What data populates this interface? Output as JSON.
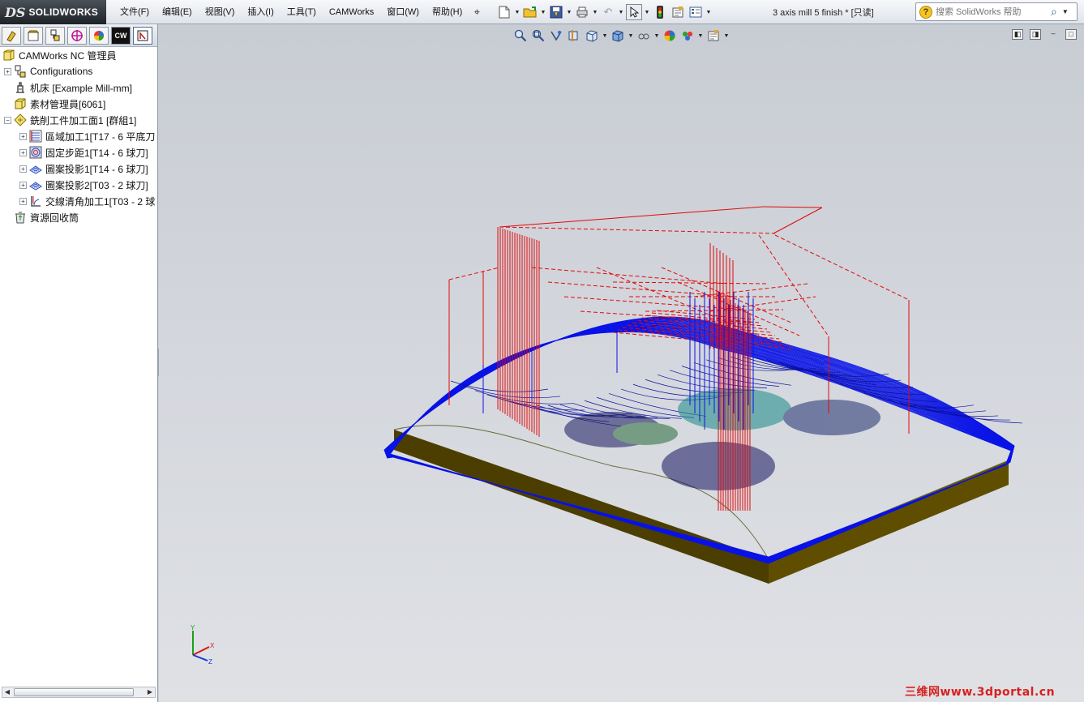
{
  "app": {
    "logo_mark": "DS",
    "logo_text": "SOLIDWORKS",
    "document_title": "3 axis mill 5 finish * [只读]"
  },
  "menu": [
    {
      "key": "file",
      "label": "文件(F)"
    },
    {
      "key": "edit",
      "label": "编辑(E)"
    },
    {
      "key": "view",
      "label": "视图(V)"
    },
    {
      "key": "insert",
      "label": "插入(I)"
    },
    {
      "key": "tools",
      "label": "工具(T)"
    },
    {
      "key": "camworks",
      "label": "CAMWorks"
    },
    {
      "key": "window",
      "label": "窗口(W)"
    },
    {
      "key": "help",
      "label": "帮助(H)"
    }
  ],
  "search": {
    "placeholder": "搜索 SolidWorks 帮助",
    "icon": "magnifier-icon"
  },
  "panel_tabs": [
    "feature-manager-icon",
    "property-manager-icon",
    "configuration-manager-icon",
    "dimxpert-icon",
    "display-manager-icon",
    "camworks-feature-tree-icon",
    "camworks-operation-tree-icon"
  ],
  "tree": {
    "root": "CAMWorks NC 管理員",
    "items": [
      {
        "label": "Configurations",
        "icon": "configurations-icon",
        "expander": "+",
        "level": 1
      },
      {
        "label": "机床 [Example Mill-mm]",
        "icon": "machine-icon",
        "expander": "",
        "level": 1
      },
      {
        "label": "素材管理員[6061]",
        "icon": "stock-icon",
        "expander": "",
        "level": 1
      },
      {
        "label": "銑削工件加工面1 [群組1]",
        "icon": "mill-part-setup-icon",
        "expander": "−",
        "level": 1
      },
      {
        "label": "區域加工1[T17 - 6 平底刀",
        "icon": "area-clearance-icon",
        "expander": "+",
        "level": 2
      },
      {
        "label": "固定步距1[T14 - 6 球刀]",
        "icon": "constant-stepover-icon",
        "expander": "+",
        "level": 2
      },
      {
        "label": "圖案投影1[T14 - 6 球刀]",
        "icon": "pattern-project-icon",
        "expander": "+",
        "level": 2
      },
      {
        "label": "圖案投影2[T03 - 2 球刀]",
        "icon": "pattern-project-icon",
        "expander": "+",
        "level": 2
      },
      {
        "label": "交線清角加工1[T03 - 2 球",
        "icon": "pencil-mill-icon",
        "expander": "+",
        "level": 2
      },
      {
        "label": "資源回收筒",
        "icon": "recycle-bin-icon",
        "expander": "",
        "level": 1
      }
    ]
  },
  "triad": {
    "x": "X",
    "y": "Y",
    "z": "Z"
  },
  "watermark": "三维网www.3dportal.cn",
  "colors": {
    "stock": "#5a4a00",
    "toolpath_blue": "#0a14e6",
    "rapid_red": "#e00a0a",
    "logo_bg": "#2a3036"
  }
}
